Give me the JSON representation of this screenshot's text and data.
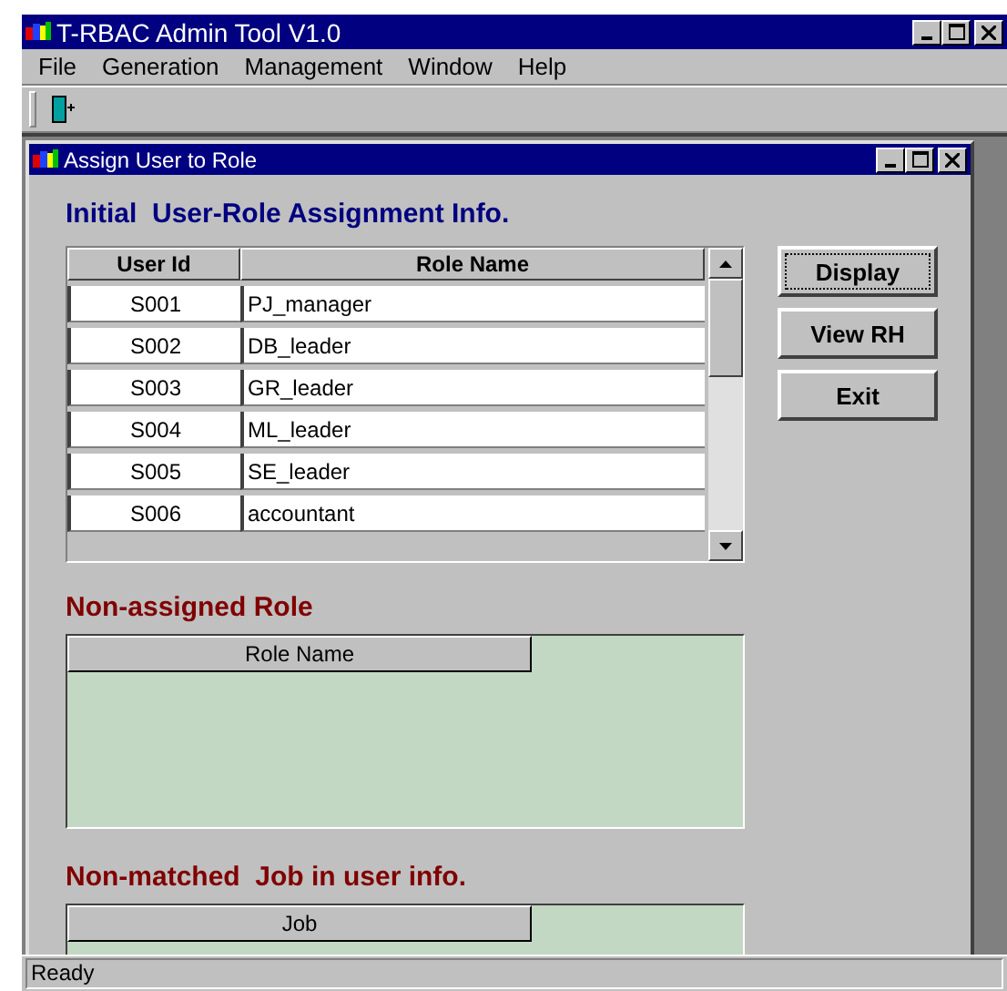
{
  "window": {
    "title": "T-RBAC Admin Tool V1.0"
  },
  "menu": [
    {
      "label": "File"
    },
    {
      "label": "Generation"
    },
    {
      "label": "Management"
    },
    {
      "label": "Window"
    },
    {
      "label": "Help"
    }
  ],
  "child_window": {
    "title": "Assign User to Role"
  },
  "assignment": {
    "heading": "Initial  User-Role Assignment Info.",
    "columns": [
      "User Id",
      "Role Name"
    ],
    "rows": [
      {
        "user_id": "S001",
        "role_name": "PJ_manager"
      },
      {
        "user_id": "S002",
        "role_name": "DB_leader"
      },
      {
        "user_id": "S003",
        "role_name": "GR_leader"
      },
      {
        "user_id": "S004",
        "role_name": "ML_leader"
      },
      {
        "user_id": "S005",
        "role_name": "SE_leader"
      },
      {
        "user_id": "S006",
        "role_name": "accountant"
      }
    ]
  },
  "buttons": [
    {
      "label": "Display",
      "focused": true
    },
    {
      "label": "View RH",
      "focused": false
    },
    {
      "label": "Exit",
      "focused": false
    }
  ],
  "non_assigned": {
    "heading": "Non-assigned Role",
    "column": "Role Name"
  },
  "non_matched": {
    "heading": "Non-matched  Job in user info.",
    "column": "Job"
  },
  "status_bar": "Ready"
}
